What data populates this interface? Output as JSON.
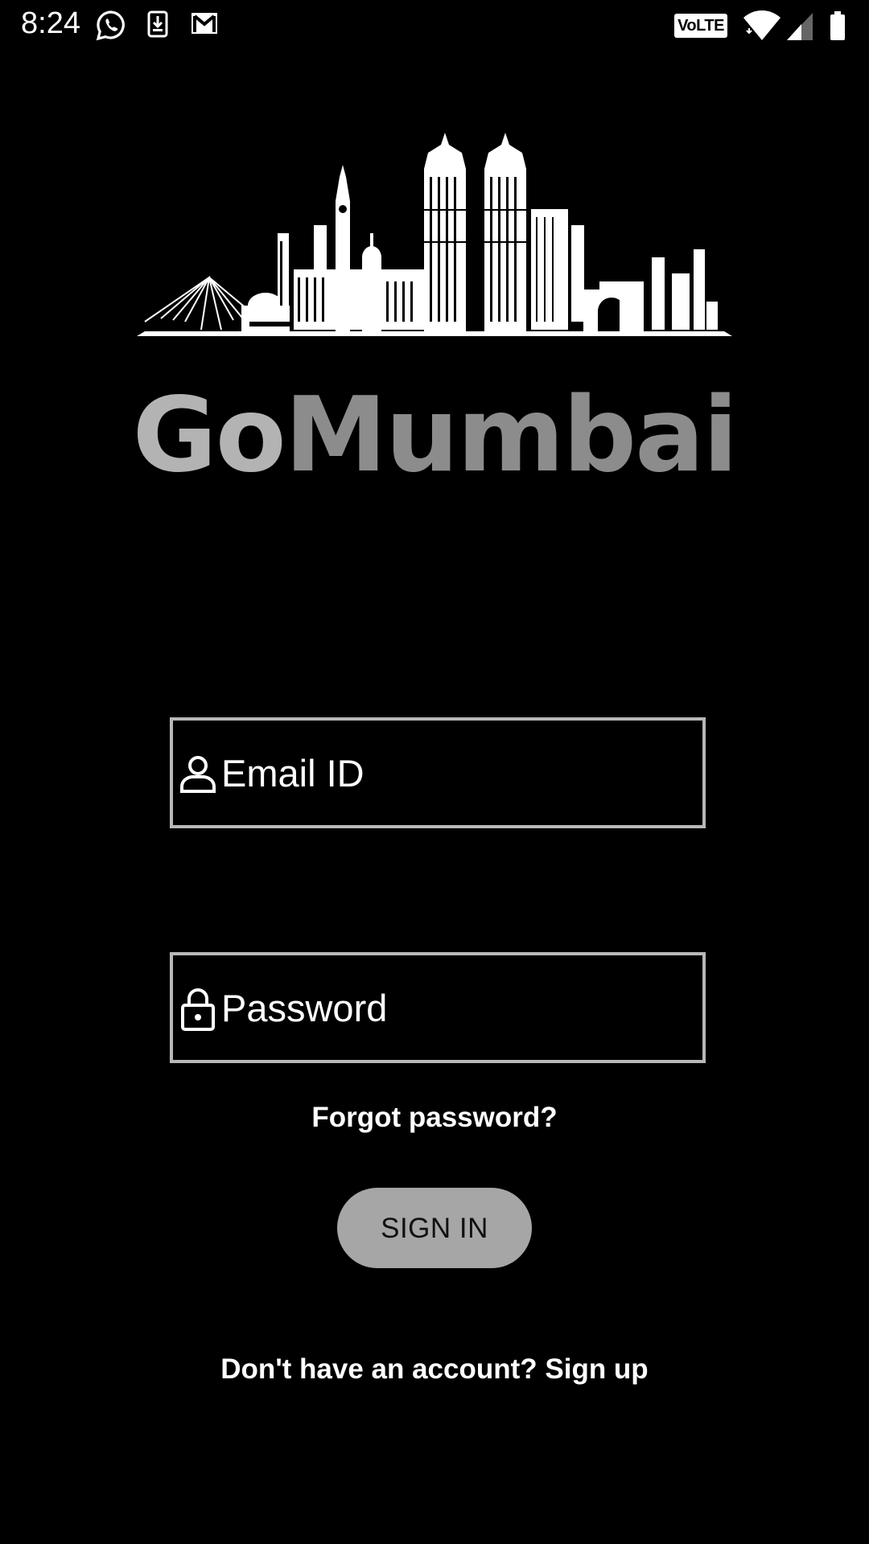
{
  "status_bar": {
    "time": "8:24",
    "volte": "VoLTE",
    "icons": [
      "whatsapp-icon",
      "download-icon",
      "gmail-icon",
      "wifi-icon",
      "signal-icon",
      "battery-icon"
    ]
  },
  "logo": {
    "brand_go": "Go",
    "brand_rest": "Mumbai",
    "colors": {
      "go": "#b3b3b3",
      "mumbai": "#8c8c8c"
    }
  },
  "form": {
    "email_placeholder": "Email ID",
    "email_value": "",
    "password_placeholder": "Password",
    "password_value": "",
    "forgot_label": "Forgot password?",
    "signin_label": "SIGN IN",
    "signup_label": "Don't have an account? Sign up"
  },
  "colors": {
    "background": "#000000",
    "field_border": "#b8b8b8",
    "button_bg": "#a6a6a6"
  }
}
